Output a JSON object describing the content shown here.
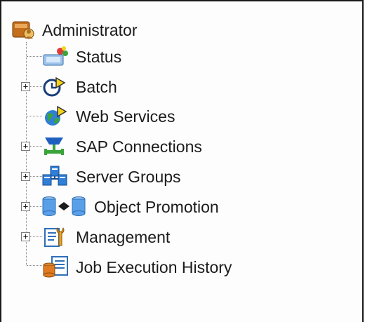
{
  "tree": {
    "root": {
      "label": "Administrator",
      "icon": "administrator-icon"
    },
    "expand_glyph": "+",
    "items": [
      {
        "label": "Status",
        "icon": "status-icon",
        "expandable": false
      },
      {
        "label": "Batch",
        "icon": "batch-icon",
        "expandable": true
      },
      {
        "label": "Web Services",
        "icon": "web-services-icon",
        "expandable": false
      },
      {
        "label": "SAP Connections",
        "icon": "sap-connections-icon",
        "expandable": true
      },
      {
        "label": "Server Groups",
        "icon": "server-groups-icon",
        "expandable": true
      },
      {
        "label": "Object Promotion",
        "icon": "object-promotion-icon",
        "expandable": true
      },
      {
        "label": "Management",
        "icon": "management-icon",
        "expandable": true
      },
      {
        "label": "Job Execution History",
        "icon": "job-execution-history-icon",
        "expandable": false
      }
    ]
  },
  "colors": {
    "line": "#8a8a8a",
    "text": "#1b1b1b",
    "accent_blue": "#2f7fd8",
    "accent_orange": "#f08a1a",
    "accent_green": "#3ba33b",
    "accent_yellow": "#f5d21a"
  }
}
